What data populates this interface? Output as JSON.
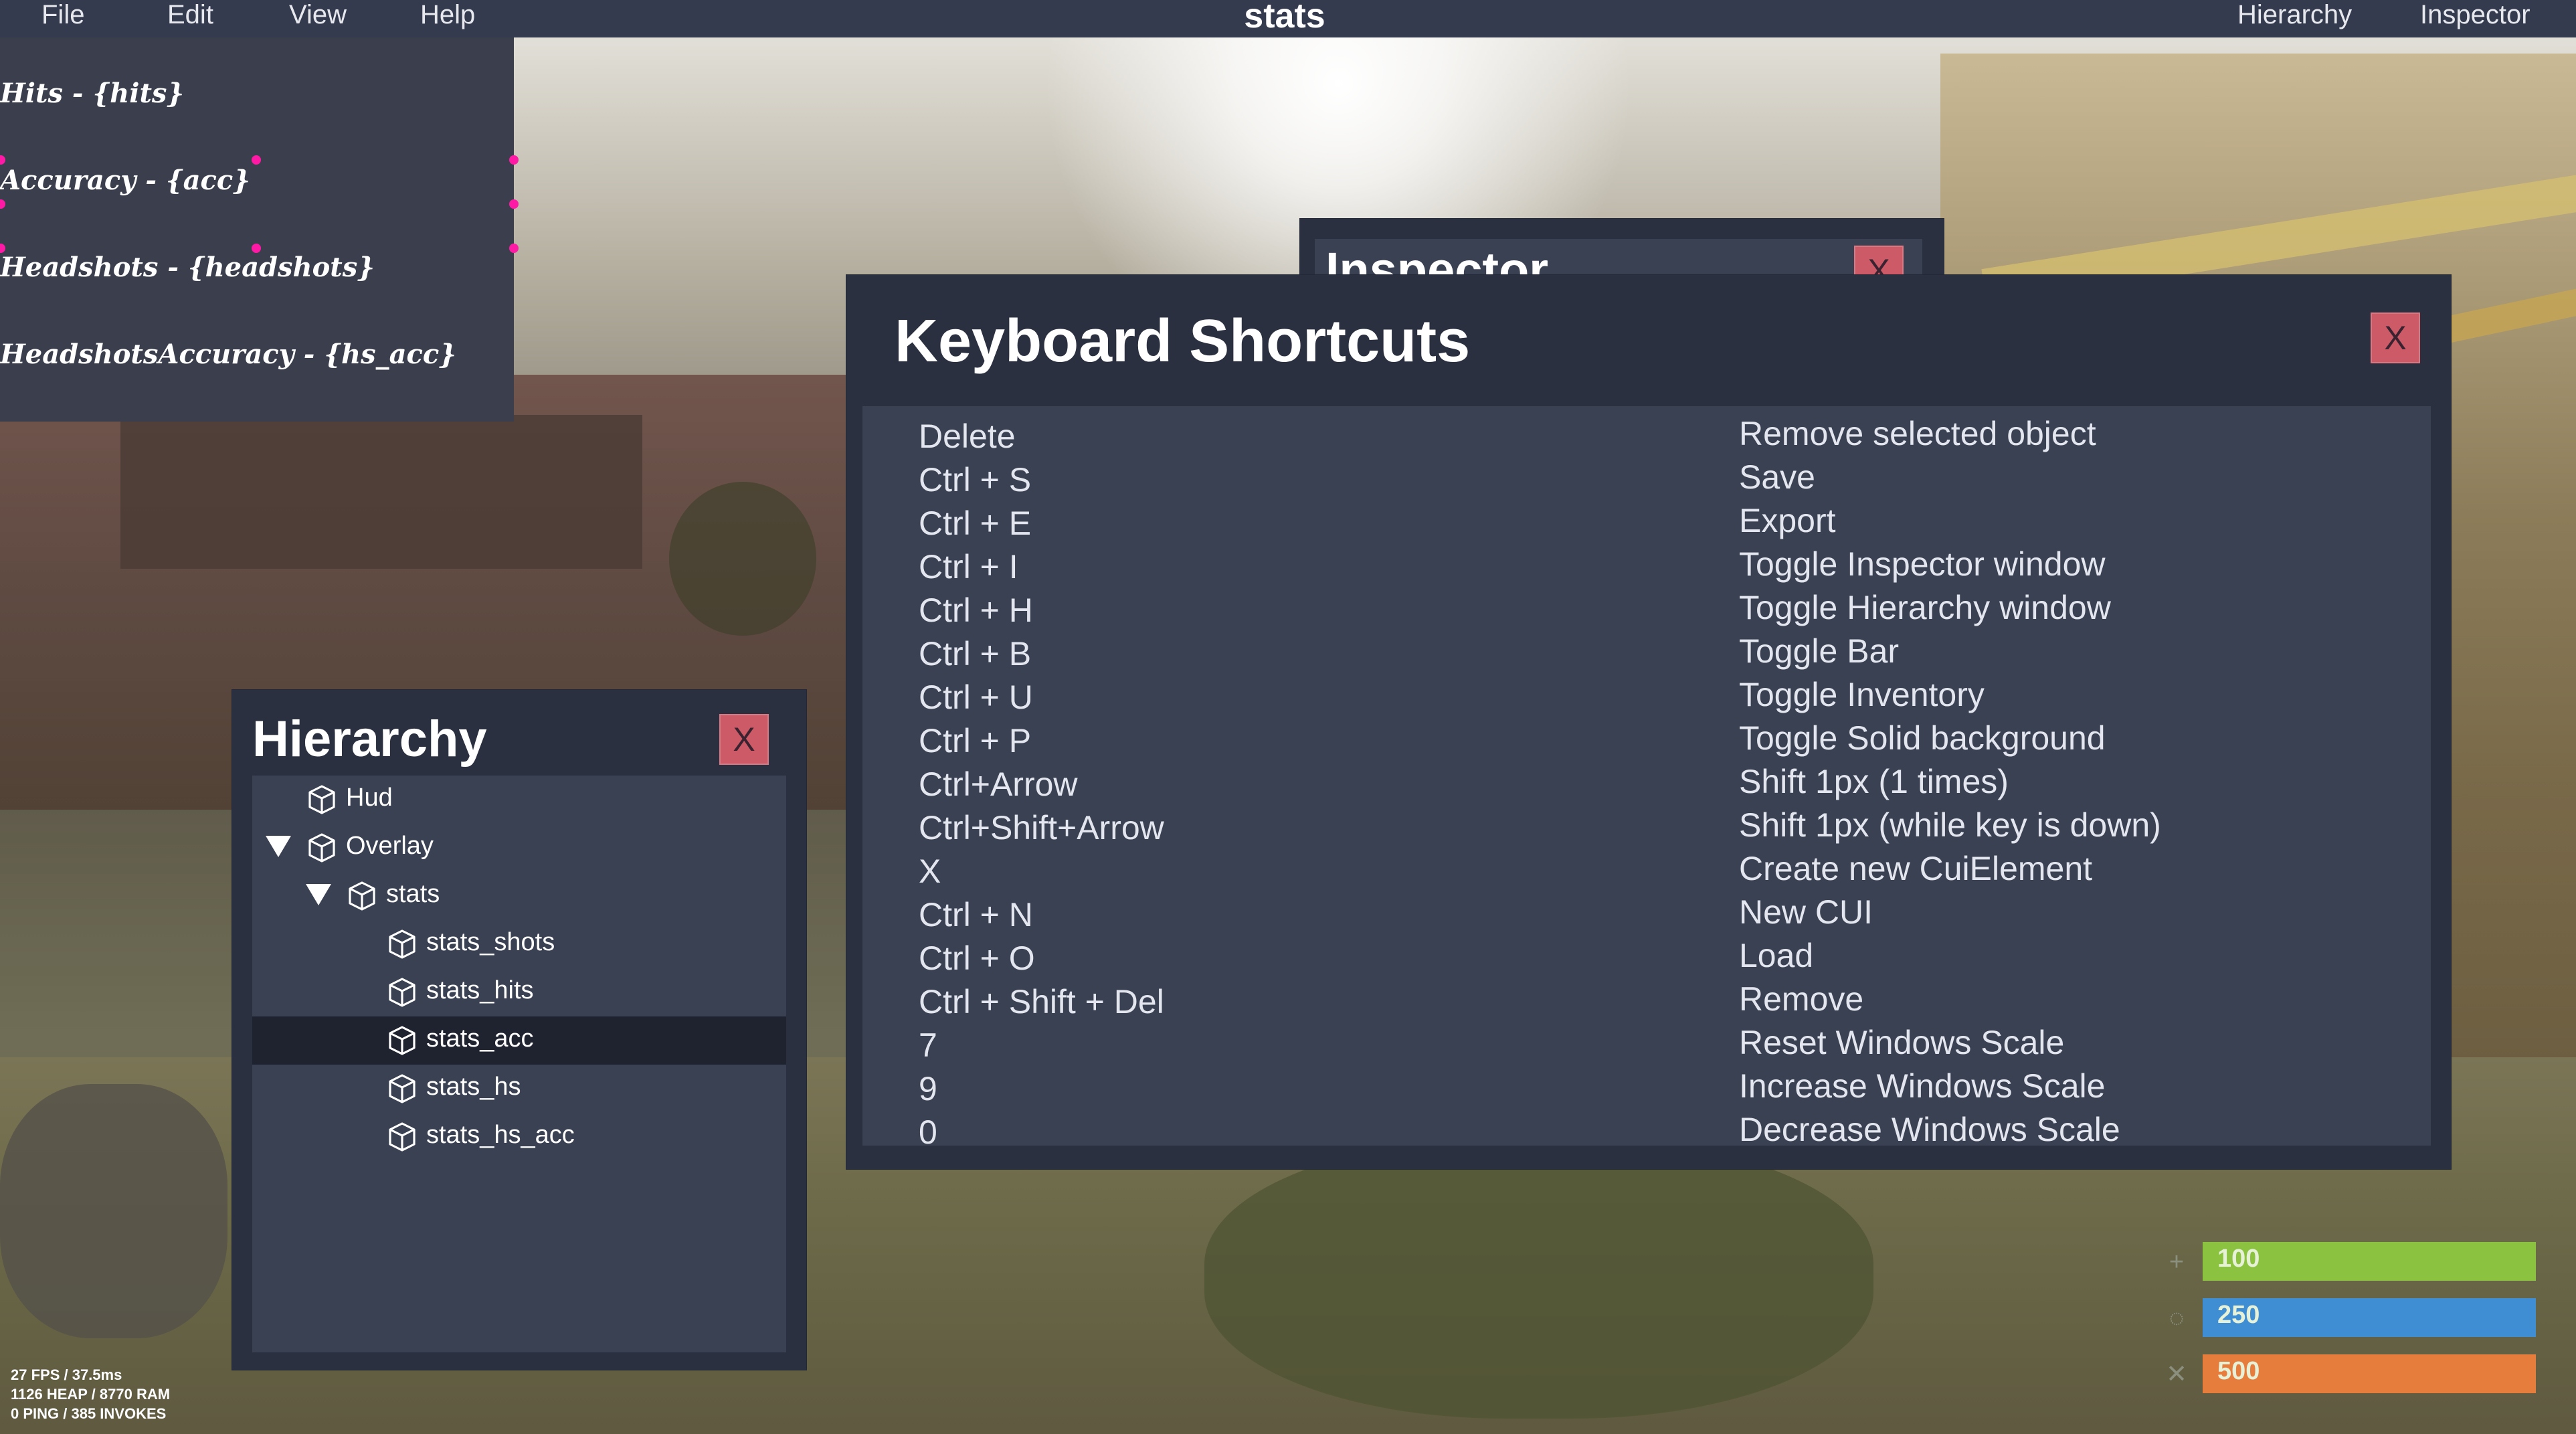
{
  "menubar": {
    "items": [
      "File",
      "Edit",
      "View",
      "Help"
    ],
    "title": "stats",
    "right_items": [
      "Hierarchy",
      "Inspector"
    ]
  },
  "stats_overlay": {
    "lines": [
      "Hits - {hits}",
      "Accuracy - {acc}",
      "Headshots - {headshots}",
      "HeadshotsAccuracy - {hs_acc}"
    ],
    "handle_color": "#ff1aa6"
  },
  "inspector_window": {
    "title": "Inspector",
    "close_label": "X"
  },
  "shortcuts_window": {
    "title": "Keyboard Shortcuts",
    "close_label": "X",
    "rows": [
      {
        "key": "Delete",
        "action": "Remove selected object"
      },
      {
        "key": "Ctrl + S",
        "action": "Save"
      },
      {
        "key": "Ctrl + E",
        "action": "Export"
      },
      {
        "key": "Ctrl + I",
        "action": "Toggle Inspector window"
      },
      {
        "key": "Ctrl + H",
        "action": "Toggle Hierarchy window"
      },
      {
        "key": "Ctrl + B",
        "action": "Toggle Bar"
      },
      {
        "key": "Ctrl + U",
        "action": "Toggle Inventory"
      },
      {
        "key": "Ctrl + P",
        "action": "Toggle Solid background"
      },
      {
        "key": "Ctrl+Arrow",
        "action": "Shift 1px (1 times)"
      },
      {
        "key": "Ctrl+Shift+Arrow",
        "action": "Shift 1px (while key is down)"
      },
      {
        "key": "X",
        "action": "Create new CuiElement"
      },
      {
        "key": "Ctrl + N",
        "action": "New CUI"
      },
      {
        "key": "Ctrl + O",
        "action": "Load"
      },
      {
        "key": "Ctrl + Shift + Del",
        "action": "Remove"
      },
      {
        "key": "7",
        "action": "Reset Windows Scale"
      },
      {
        "key": "9",
        "action": "Increase Windows Scale"
      },
      {
        "key": "0",
        "action": "Decrease Windows Scale"
      }
    ]
  },
  "hierarchy_window": {
    "title": "Hierarchy",
    "close_label": "X",
    "tree": [
      {
        "label": "Hud",
        "depth": 0,
        "expanded": false,
        "selected": false
      },
      {
        "label": "Overlay",
        "depth": 0,
        "expanded": true,
        "selected": false
      },
      {
        "label": "stats",
        "depth": 1,
        "expanded": true,
        "selected": false
      },
      {
        "label": "stats_shots",
        "depth": 2,
        "expanded": false,
        "selected": false
      },
      {
        "label": "stats_hits",
        "depth": 2,
        "expanded": false,
        "selected": false
      },
      {
        "label": "stats_acc",
        "depth": 2,
        "expanded": false,
        "selected": true
      },
      {
        "label": "stats_hs",
        "depth": 2,
        "expanded": false,
        "selected": false
      },
      {
        "label": "stats_hs_acc",
        "depth": 2,
        "expanded": false,
        "selected": false
      }
    ]
  },
  "status_bars": [
    {
      "value": "100",
      "color": "#8bc240"
    },
    {
      "value": "250",
      "color": "#3f8ed3"
    },
    {
      "value": "500",
      "color": "#e67d3c"
    }
  ],
  "fps_info": {
    "lines": [
      "27 FPS / 37.5ms",
      "1126 HEAP / 8770 RAM",
      "0 PING / 385 INVOKES"
    ]
  },
  "colors": {
    "menubar_bg": "#343b4e",
    "window_bg": "#2a3040",
    "window_body_bg": "#3a4152",
    "close_button_bg": "#cc5b67",
    "selected_row_bg": "#1f2330"
  }
}
